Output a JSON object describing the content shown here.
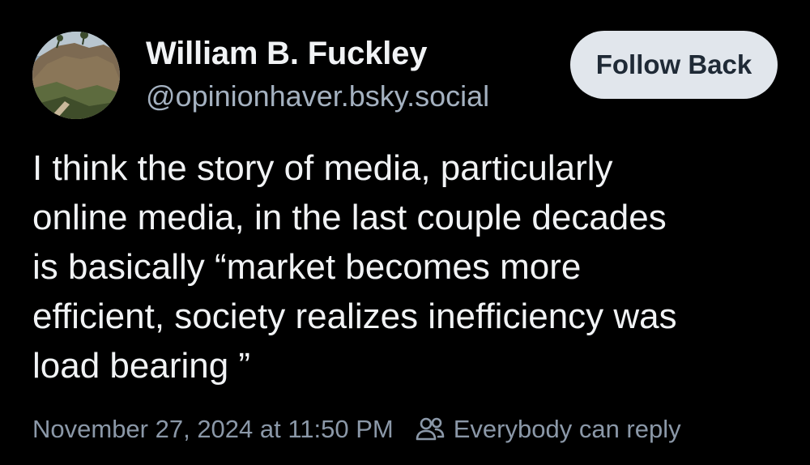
{
  "author": {
    "display_name": "William B. Fuckley",
    "handle": "@opinionhaver.bsky.social",
    "avatar_icon": "avatar-cliff-photo"
  },
  "follow_button": {
    "label": "Follow Back"
  },
  "post": {
    "lines": [
      "I think the story of media, particularly",
      "online media, in the last couple decades",
      "is basically “market becomes more",
      "efficient, society realizes inefficiency was",
      "load bearing ”"
    ]
  },
  "meta": {
    "timestamp": "November 27, 2024 at 11:50 PM",
    "reply_icon": "people-icon",
    "reply_setting": "Everybody can reply"
  },
  "colors": {
    "background": "#000000",
    "text_primary": "#f1f3f5",
    "text_secondary": "#a4b1c0",
    "text_meta": "#8b98a8",
    "button_bg": "#e1e6ec",
    "button_text": "#1f2a36"
  }
}
